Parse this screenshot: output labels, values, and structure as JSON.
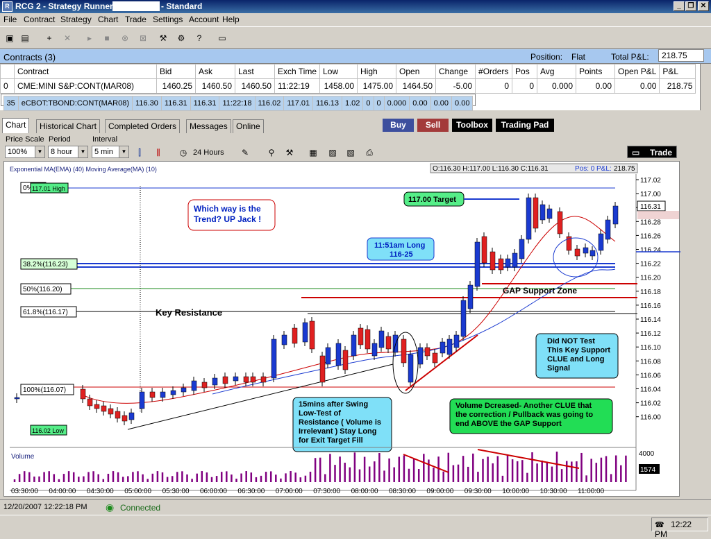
{
  "window": {
    "title": "RCG 2 - Strategy Runner",
    "title_suffix": " - Standard",
    "icon": "app-icon"
  },
  "menu": [
    "File",
    "Contract",
    "Strategy",
    "Chart",
    "Trade",
    "Settings",
    "Account",
    "Help"
  ],
  "contracts": {
    "header": "Contracts (3)",
    "position_label": "Position:",
    "position_value": "Flat",
    "total_pl_label": "Total P&L:",
    "total_pl_value": "218.75",
    "columns": [
      "",
      "Contract",
      "Bid",
      "Ask",
      "Last",
      "Exch Time",
      "Low",
      "High",
      "Open",
      "Change",
      "#Orders",
      "Pos",
      "Avg",
      "Points",
      "Open P&L",
      "P&L"
    ],
    "rows": [
      [
        "0",
        "CME:MINI S&P:CONT(MAR08)",
        "1460.25",
        "1460.50",
        "1460.50",
        "11:22:19",
        "1458.00",
        "1475.00",
        "1464.50",
        "-5.00",
        "0",
        "0",
        "0.000",
        "0.00",
        "0.00",
        "218.75"
      ],
      [
        "35",
        "eCBOT:TBOND:CONT(MAR08)",
        "116.30",
        "116.31",
        "116.31",
        "11:22:18",
        "116.02",
        "117.01",
        "116.13",
        "1.02",
        "0",
        "0",
        "0.000",
        "0.00",
        "0.00",
        "0.00"
      ]
    ]
  },
  "tabs": [
    "Chart",
    "Historical Chart",
    "Completed Orders",
    "Messages",
    "Online"
  ],
  "actions": {
    "buy": "Buy",
    "sell": "Sell",
    "toolbox": "Toolbox",
    "trading_pad": "Trading Pad",
    "trade": "Trade"
  },
  "chart_controls": {
    "price_scale_label": "Price Scale",
    "price_scale": "100%",
    "period_label": "Period",
    "period": "8 hour",
    "interval_label": "Interval",
    "interval": "5 min",
    "hours_label": "24 Hours"
  },
  "chart_header": {
    "indicators": "Exponential MA(EMA) (40)  Moving Average(MA) (10)",
    "ohlc": "O:116.30  H:117.00  L:116.30  C:116.31",
    "pos": "Pos: 0",
    "pl": "P&L:",
    "pl_value": "218.75",
    "last_price": "116.31"
  },
  "fib_labels": [
    "0%",
    "38.2%(116.23)",
    "50%(116.20)",
    "61.8%(116.17)",
    "100%(116.07)"
  ],
  "hi_low": {
    "high": "117.01 High",
    "low": "116.02 Low"
  },
  "annotations": {
    "trend": "Which way is the Trend? UP Jack !",
    "target": "117.00 Target",
    "long": "11:51am Long 116-25",
    "gap": "GAP Support Zone",
    "key_res": "Key Resistance",
    "did_not": "Did NOT Test This Key Support CLUE and Long Signal",
    "swing": "15mins after Swing Low-Test of Resistance ( Volume is Irrelevant ) Stay Long for Exit Target Fill",
    "volume": "Volume Dcreased- Another CLUE that the correction / Pullback was going to end ABOVE the GAP Support"
  },
  "volume_label": "Volume",
  "volume_axis": {
    "top": "4000",
    "current": "1574"
  },
  "chart_data": {
    "type": "candlestick",
    "y_ticks": [
      "117.02",
      "117.00",
      "116.30",
      "116.28",
      "116.26",
      "116.24",
      "116.22",
      "116.20",
      "116.18",
      "116.16",
      "116.14",
      "116.12",
      "116.10",
      "116.08",
      "116.06",
      "116.04",
      "116.02",
      "116.00"
    ],
    "x_ticks": [
      "03:30:00",
      "04:00:00",
      "04:30:00",
      "05:00:00",
      "05:30:00",
      "06:00:00",
      "06:30:00",
      "07:00:00",
      "07:30:00",
      "08:00:00",
      "08:30:00",
      "09:00:00",
      "09:30:00",
      "10:00:00",
      "10:30:00",
      "11:00:00"
    ],
    "ylim": [
      116.0,
      117.03
    ]
  },
  "status": {
    "datetime": "12/20/2007 12:22:18 PM",
    "connection": "Connected"
  },
  "taskbar": {
    "clock": "12:22 PM"
  }
}
